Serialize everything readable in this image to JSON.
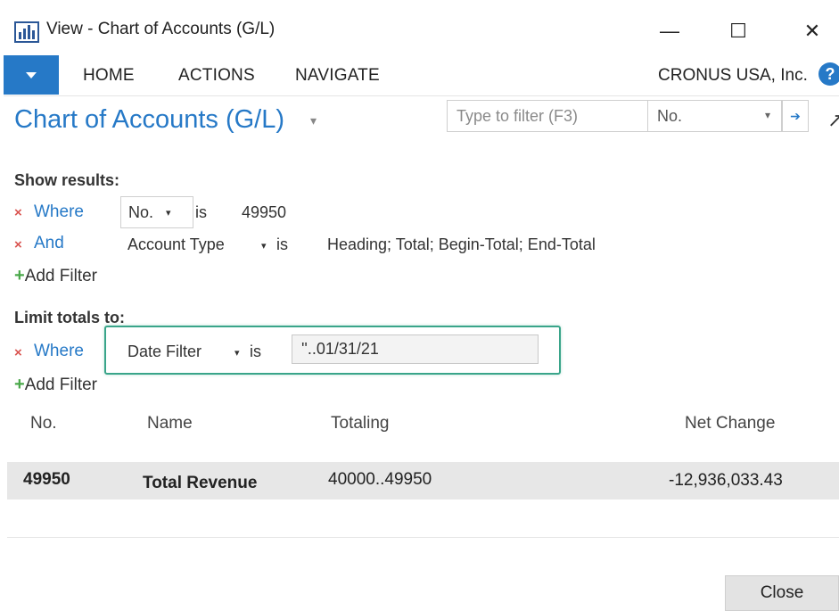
{
  "window": {
    "title": "View - Chart of Accounts (G/L)",
    "controls": {
      "minimize": "—",
      "maximize": "☐",
      "close": "✕"
    }
  },
  "ribbon": {
    "tabs": [
      "HOME",
      "ACTIONS",
      "NAVIGATE"
    ],
    "company": "CRONUS USA, Inc.",
    "help": "?"
  },
  "page": {
    "title": "Chart of Accounts (G/L)",
    "title_caret": "▾",
    "search_placeholder": "Type to filter (F3)",
    "search_field": "No."
  },
  "show_results": {
    "label": "Show results:",
    "filters": [
      {
        "connector": "Where",
        "field": "No.",
        "operator": "is",
        "value": "49950"
      },
      {
        "connector": "And",
        "field": "Account Type",
        "operator": "is",
        "value": "Heading; Total; Begin-Total; End-Total"
      }
    ],
    "add_filter": "Add Filter"
  },
  "limit_totals": {
    "label": "Limit totals to:",
    "filter": {
      "connector": "Where",
      "field": "Date Filter",
      "operator": "is",
      "value": "''..01/31/21"
    },
    "add_filter": "Add Filter"
  },
  "table": {
    "columns": [
      "No.",
      "Name",
      "Totaling",
      "Net Change"
    ],
    "rows": [
      {
        "no": "49950",
        "name": "Total Revenue",
        "totaling": "40000..49950",
        "net_change": "-12,936,033.43"
      }
    ]
  },
  "footer": {
    "close_label": "Close"
  },
  "colors": {
    "accent": "#2679c7",
    "highlight": "#3aa58a",
    "remove": "#d9534f",
    "add": "#4aa84a"
  }
}
